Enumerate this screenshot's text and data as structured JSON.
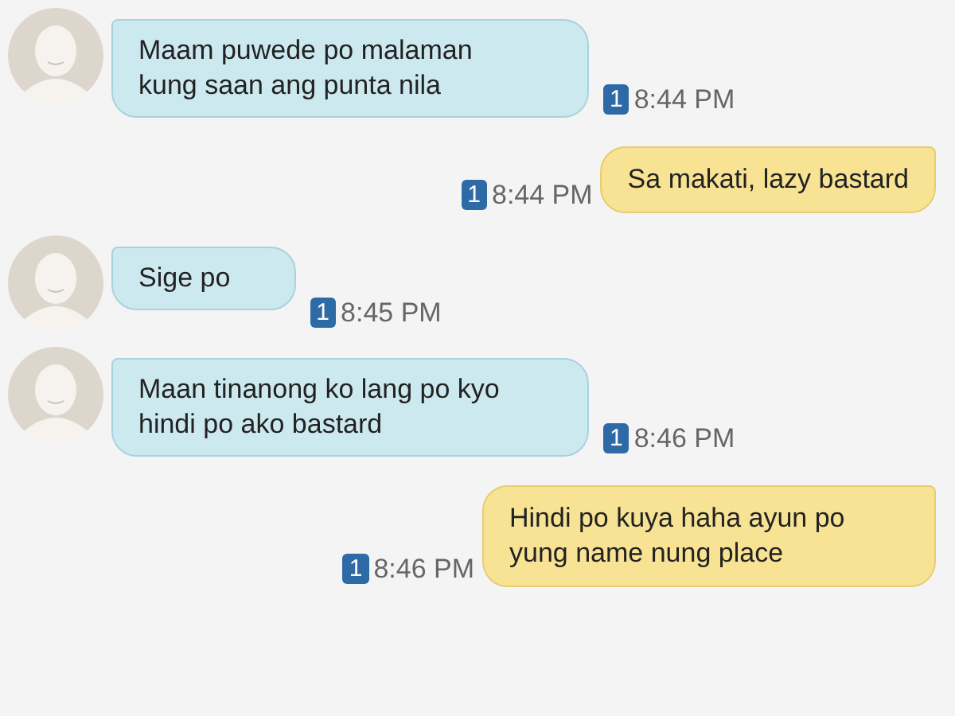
{
  "messages": [
    {
      "kind": "incoming",
      "text": " Maam puwede po malaman kung saan ang punta nila",
      "sim": "1",
      "time": "8:44 PM"
    },
    {
      "kind": "outgoing",
      "text": "Sa makati, lazy bastard",
      "sim": "1",
      "time": "8:44 PM"
    },
    {
      "kind": "incoming",
      "text": "Sige po",
      "sim": "1",
      "time": "8:45 PM"
    },
    {
      "kind": "incoming",
      "text": "Maan tinanong ko lang po kyo hindi po ako bastard",
      "sim": "1",
      "time": "8:46 PM"
    },
    {
      "kind": "outgoing",
      "text": "Hindi po kuya haha ayun po yung name nung place",
      "sim": "1",
      "time": "8:46 PM"
    }
  ]
}
